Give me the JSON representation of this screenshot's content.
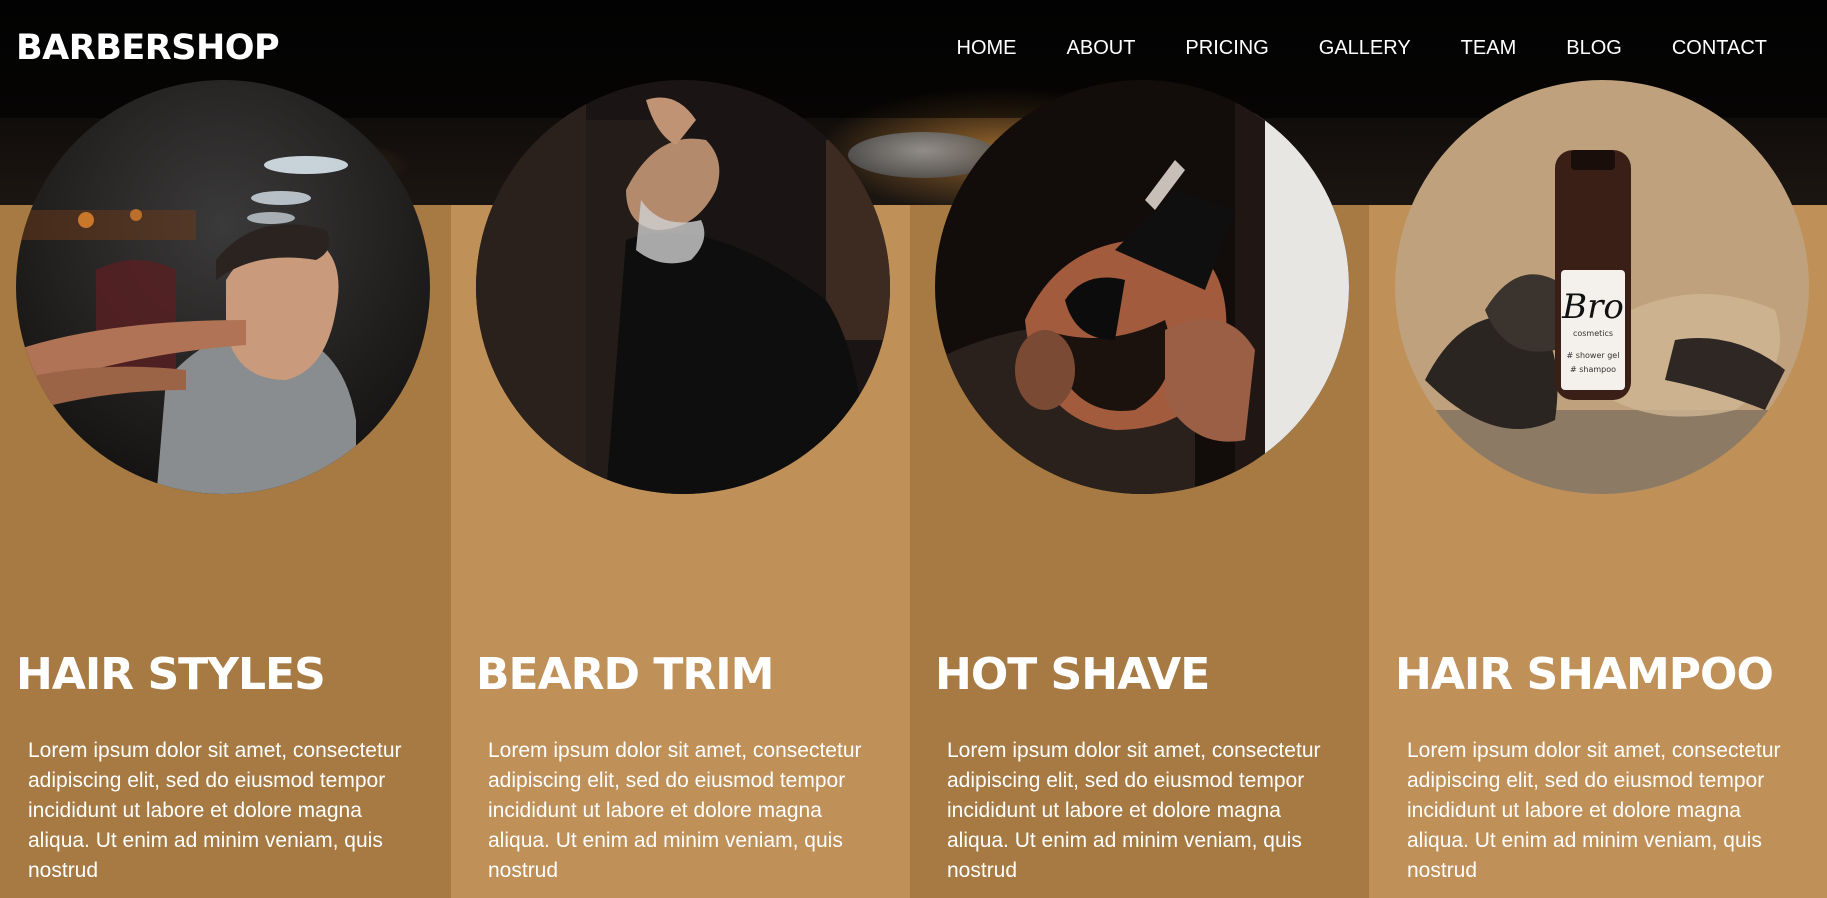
{
  "brand": {
    "name": "BARBERSHOP"
  },
  "nav": {
    "items": [
      "HOME",
      "ABOUT",
      "PRICING",
      "GALLERY",
      "TEAM",
      "BLOG",
      "CONTACT"
    ]
  },
  "colors": {
    "accent_dark": "#a67a42",
    "accent_light": "#bf9058",
    "header_bg": "#000000",
    "text": "#ffffff"
  },
  "services": [
    {
      "title": "HAIR STYLES",
      "text": "Lorem ipsum dolor sit amet, consectetur adipiscing elit, sed do eiusmod tempor incididunt ut labore et dolore magna aliqua. Ut enim ad minim veniam, quis nostrud",
      "image": "barber-styling-hair-photo"
    },
    {
      "title": "BEARD TRIM",
      "text": "Lorem ipsum dolor sit amet, consectetur adipiscing elit, sed do eiusmod tempor incididunt ut labore et dolore magna aliqua. Ut enim ad minim veniam, quis nostrud",
      "image": "beard-trim-photo"
    },
    {
      "title": "HOT SHAVE",
      "text": "Lorem ipsum dolor sit amet, consectetur adipiscing elit, sed do eiusmod tempor incididunt ut labore et dolore magna aliqua. Ut enim ad minim veniam, quis nostrud",
      "image": "hot-shave-photo"
    },
    {
      "title": "HAIR SHAMPOO",
      "text": "Lorem ipsum dolor sit amet, consectetur adipiscing elit, sed do eiusmod tempor incididunt ut labore et dolore magna aliqua. Ut enim ad minim veniam, quis nostrud",
      "image": "shampoo-bottle-photo",
      "product_label": {
        "brand": "Bro",
        "sub": "cosmetics",
        "line1": "# shower gel",
        "line2": "# shampoo"
      }
    }
  ]
}
